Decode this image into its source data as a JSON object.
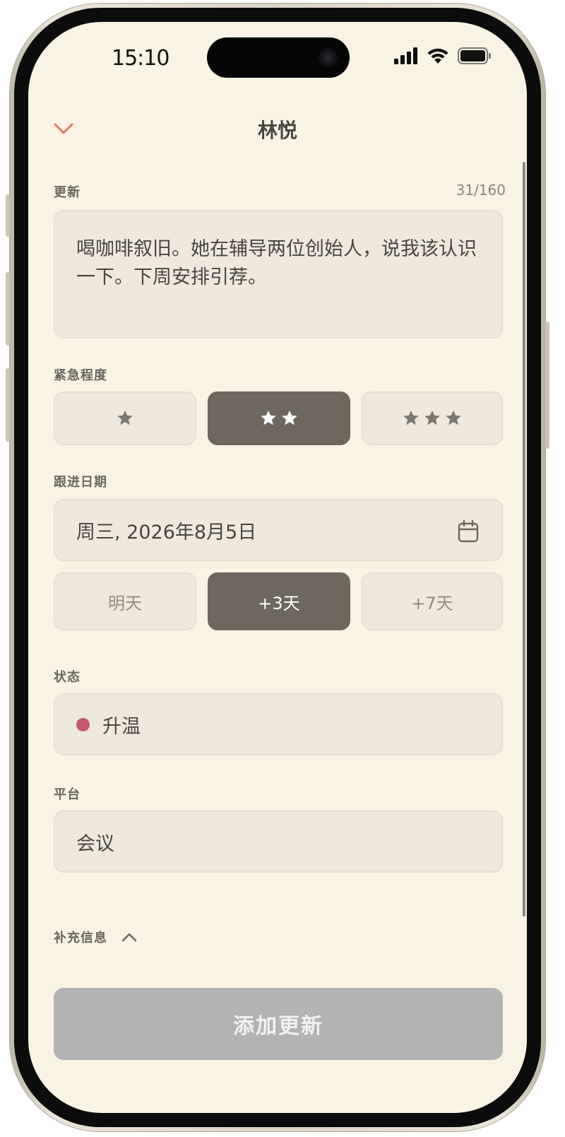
{
  "status_bar": {
    "time": "15:10"
  },
  "header": {
    "title": "林悦",
    "accent_color": "#e07a5f"
  },
  "update": {
    "label": "更新",
    "counter": "31/160",
    "text": "喝咖啡叙旧。她在辅导两位创始人，说我该认识一下。下周安排引荐。"
  },
  "urgency": {
    "label": "紧急程度",
    "options": [
      {
        "stars": 1,
        "selected": false
      },
      {
        "stars": 2,
        "selected": true
      },
      {
        "stars": 3,
        "selected": false
      }
    ]
  },
  "followup": {
    "label": "跟进日期",
    "date": "周三, 2026年8月5日",
    "quick_options": [
      {
        "label": "明天",
        "selected": false
      },
      {
        "label": "+3天",
        "selected": true
      },
      {
        "label": "+7天",
        "selected": false
      }
    ]
  },
  "status": {
    "label": "状态",
    "value": "升温",
    "dot_color": "#c25a6a"
  },
  "platform": {
    "label": "平台",
    "value": "会议"
  },
  "extra": {
    "label": "补充信息"
  },
  "submit": {
    "label": "添加更新"
  }
}
